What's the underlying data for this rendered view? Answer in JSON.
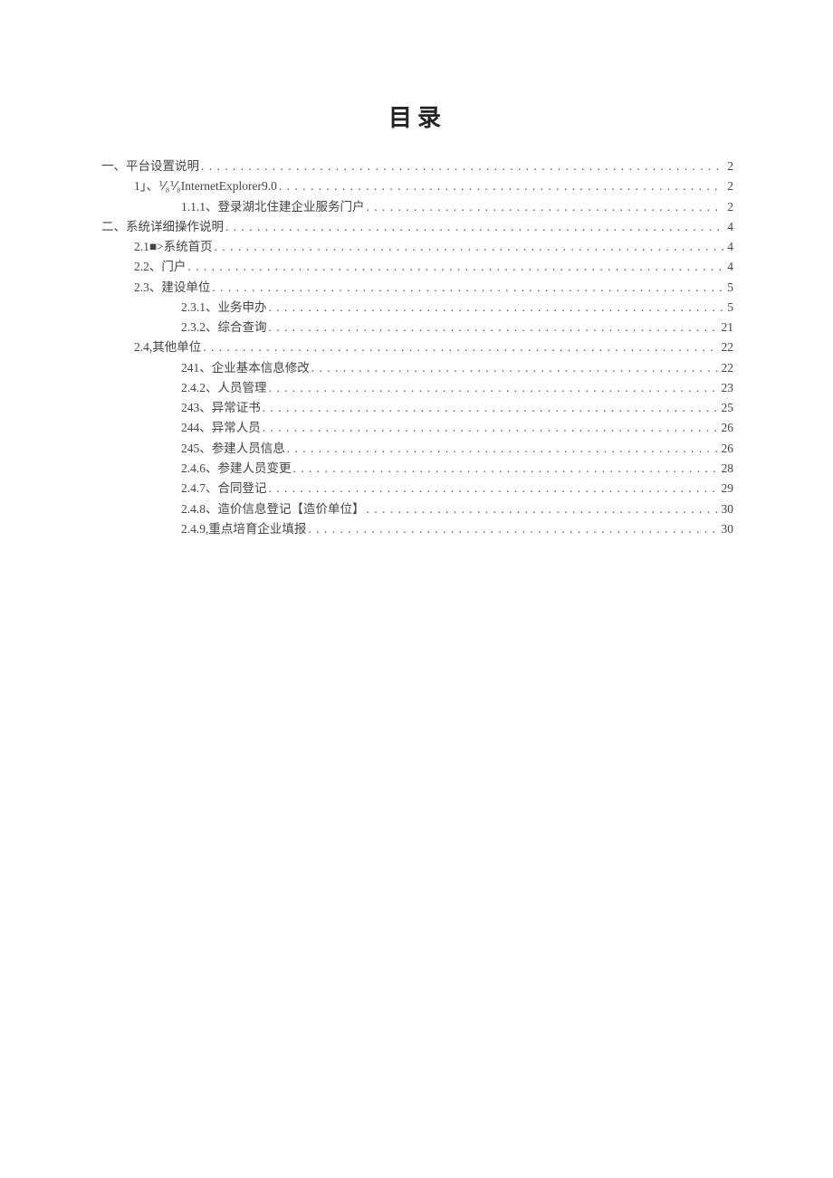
{
  "title": "目录",
  "toc": [
    {
      "indent": 0,
      "label": "一、平台设置说明",
      "page": "2"
    },
    {
      "indent": 1,
      "label": "1」、⅟₈⅟₈InternetExplorer9.0",
      "page": "2"
    },
    {
      "indent": 2,
      "label": "1.1.1、登录湖北住建企业服务门户",
      "page": "2"
    },
    {
      "indent": 0,
      "label": "二、系统详细操作说明",
      "page": "4"
    },
    {
      "indent": 1,
      "label": "2.1■>系统首页",
      "page": "4"
    },
    {
      "indent": 1,
      "label": "2.2、门户",
      "page": "4"
    },
    {
      "indent": 1,
      "label": "2.3、建设单位",
      "page": "5"
    },
    {
      "indent": 2,
      "label": "2.3.1、业务申办",
      "page": "5"
    },
    {
      "indent": 2,
      "label": "2.3.2、综合查询",
      "page": "21"
    },
    {
      "indent": 1,
      "label": "2.4,其他单位",
      "page": "22"
    },
    {
      "indent": 2,
      "label": "241、企业基本信息修改",
      "page": "22"
    },
    {
      "indent": 2,
      "label": "2.4.2、人员管理",
      "page": "23"
    },
    {
      "indent": 2,
      "label": "243、异常证书",
      "page": "25"
    },
    {
      "indent": 2,
      "label": "244、异常人员",
      "page": "26"
    },
    {
      "indent": 2,
      "label": "245、参建人员信息",
      "page": "26"
    },
    {
      "indent": 2,
      "label": "2.4.6、参建人员变更",
      "page": "28"
    },
    {
      "indent": 2,
      "label": "2.4.7、合同登记",
      "page": "29"
    },
    {
      "indent": 2,
      "label": "2.4.8、造价信息登记【造价单位】",
      "page": "30"
    },
    {
      "indent": 2,
      "label": "2.4.9,重点培育企业填报",
      "page": "30"
    }
  ]
}
